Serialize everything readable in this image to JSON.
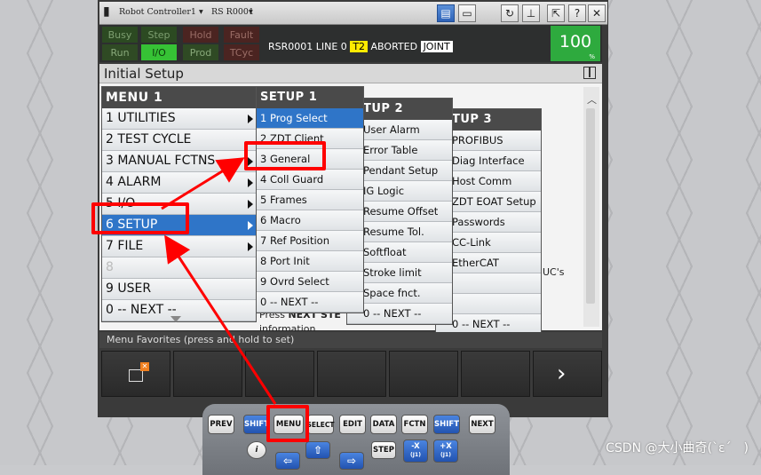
{
  "window": {
    "title": "Robot Controller1",
    "robot": "RS R0001",
    "buttons": [
      "display-mode-icon",
      "keyboard-icon",
      "refresh-icon",
      "pin-icon",
      "restore-icon",
      "help-icon",
      "close-icon"
    ]
  },
  "status": {
    "leds": [
      {
        "label": "Busy",
        "state": "off"
      },
      {
        "label": "Step",
        "state": "off"
      },
      {
        "label": "Hold",
        "state": "off"
      },
      {
        "label": "Fault",
        "state": "off"
      },
      {
        "label": "Run",
        "state": "off"
      },
      {
        "label": "I/O",
        "state": "on"
      },
      {
        "label": "Prod",
        "state": "off"
      },
      {
        "label": "TCyc",
        "state": "off"
      }
    ],
    "program": "RSR0001 LINE 0",
    "mode": "T2",
    "state": "ABORTED",
    "coord": "JOINT",
    "override": "100",
    "override_unit": "%"
  },
  "screen": {
    "title": "Initial Setup"
  },
  "menu1": {
    "header": "MENU  1",
    "items": [
      {
        "label": "1 UTILITIES",
        "arrow": true
      },
      {
        "label": "2 TEST CYCLE",
        "arrow": false
      },
      {
        "label": "3 MANUAL FCTNS",
        "arrow": true
      },
      {
        "label": "4 ALARM",
        "arrow": true
      },
      {
        "label": "5 I/O",
        "arrow": true
      },
      {
        "label": "6 SETUP",
        "arrow": true,
        "selected": true
      },
      {
        "label": "7 FILE",
        "arrow": true
      },
      {
        "label": "8",
        "arrow": false,
        "dim": true
      },
      {
        "label": "9 USER",
        "arrow": false
      },
      {
        "label": "0 -- NEXT --",
        "arrow": false
      }
    ]
  },
  "setup1": {
    "header": "SETUP  1",
    "items": [
      {
        "label": "1 Prog Select",
        "selected": true
      },
      {
        "label": "2 ZDT Client"
      },
      {
        "label": "3 General"
      },
      {
        "label": "4 Coll Guard"
      },
      {
        "label": "5 Frames"
      },
      {
        "label": "6 Macro"
      },
      {
        "label": "7 Ref Position"
      },
      {
        "label": "8 Port Init"
      },
      {
        "label": "9 Ovrd Select"
      },
      {
        "label": "0 -- NEXT --"
      }
    ]
  },
  "setup2": {
    "header": "TUP  2",
    "items": [
      "User Alarm",
      "Error Table",
      "Pendant Setup",
      "IG Logic",
      "Resume Offset",
      "Resume Tol.",
      "Softfloat",
      "Stroke limit",
      "Space fnct.",
      "0 -- NEXT --"
    ]
  },
  "setup3": {
    "header": "TUP  3",
    "items": [
      "PROFIBUS",
      "Diag Interface",
      "Host Comm",
      "ZDT EOAT Setup",
      "Passwords",
      "CC-Link",
      "EtherCAT",
      "",
      "",
      "0 -- NEXT --"
    ]
  },
  "background_text": {
    "ucs": "UC's",
    "press": "Press",
    "press_bold": "NEXT STE",
    "information": "information"
  },
  "footer": {
    "favorites": "Menu Favorites (press and hold to set)"
  },
  "pendant": {
    "row1": [
      "PREV",
      "SHIFT",
      "MENU",
      "SELECT",
      "EDIT",
      "DATA",
      "FCTN",
      "SHIFT",
      "NEXT"
    ],
    "step": "STEP",
    "minus_x": "-X",
    "minus_j1": "(J1)",
    "plus_x": "+X",
    "plus_j1": "(J1)",
    "info": "i"
  },
  "watermark": "CSDN @大小曲奇(`ε´　)"
}
